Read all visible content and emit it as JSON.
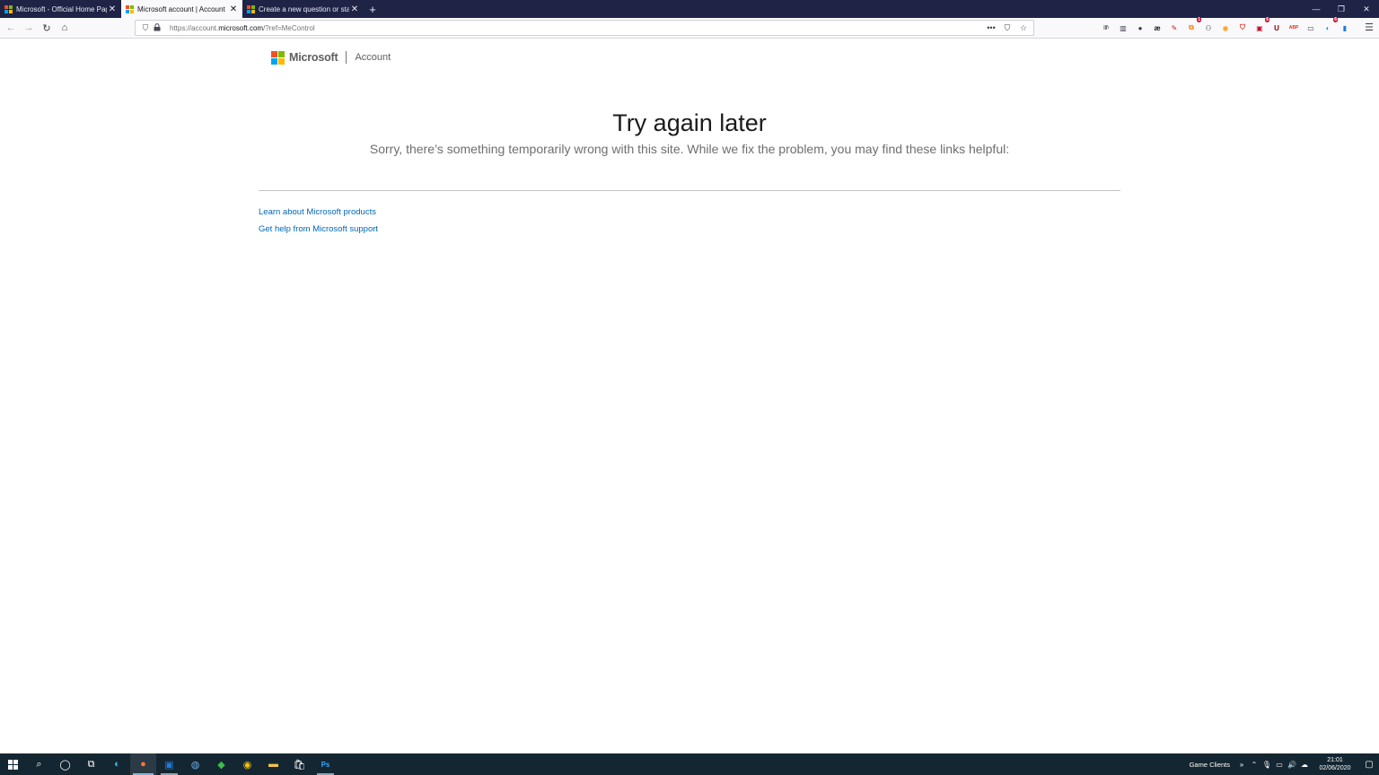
{
  "browser": {
    "tabs": [
      {
        "title": "Microsoft - Official Home Page",
        "active": false
      },
      {
        "title": "Microsoft account | Account",
        "active": true
      },
      {
        "title": "Create a new question or start a",
        "active": false
      }
    ],
    "new_tab_symbol": "+",
    "window_controls": {
      "minimize": "—",
      "restore": "❐",
      "close": "✕"
    },
    "url_prefix": "https://account.",
    "url_domain": "microsoft.com",
    "url_suffix": "/?ref=MeControl",
    "extensions": [
      {
        "name": "library-icon",
        "glyph": "|||\\",
        "color": "#3b3b45"
      },
      {
        "name": "sidebar-icon",
        "glyph": "▥",
        "color": "#3b3b45"
      },
      {
        "name": "account-icon",
        "glyph": "●",
        "color": "#3b3b45"
      },
      {
        "name": "ae-extension-icon",
        "glyph": "æ",
        "color": "#15141a"
      },
      {
        "name": "red-pen-extension-icon",
        "glyph": "✎",
        "color": "#d01717"
      },
      {
        "name": "orange-extension-icon",
        "glyph": "⧉",
        "color": "#f28c28",
        "badge": "1"
      },
      {
        "name": "group-extension-icon",
        "glyph": "⚇",
        "color": "#3b3b45"
      },
      {
        "name": "honey-extension-icon",
        "glyph": "◉",
        "color": "#f29e1f"
      },
      {
        "name": "brave-shield-icon",
        "glyph": "⛉",
        "color": "#e0301e"
      },
      {
        "name": "red-extension-icon",
        "glyph": "▣",
        "color": "#c8102e",
        "badge": "6"
      },
      {
        "name": "ublock-icon",
        "glyph": "U",
        "color": "#800000"
      },
      {
        "name": "abp-icon",
        "glyph": "ABP",
        "color": "#e0301e"
      },
      {
        "name": "square-extension-icon",
        "glyph": "▭",
        "color": "#3b3b45"
      },
      {
        "name": "teal-extension-icon",
        "glyph": "◐",
        "color": "#19a3a3",
        "badge": "6"
      },
      {
        "name": "trello-extension-icon",
        "glyph": "▮",
        "color": "#1f7bd0"
      }
    ]
  },
  "page": {
    "brand": "Microsoft",
    "section": "Account",
    "title": "Try again later",
    "subtitle": "Sorry, there’s something temporarily wrong with this site. While we fix the problem, you may find these links helpful:",
    "links": [
      "Learn about Microsoft products",
      "Get help from Microsoft support"
    ]
  },
  "taskbar": {
    "tray_label": "Game Clients",
    "time": "21:01",
    "date": "02/06/2020"
  },
  "colors": {
    "ms_red": "#f25022",
    "ms_green": "#7fba00",
    "ms_blue": "#00a4ef",
    "ms_yellow": "#ffb900",
    "link": "#0067b8",
    "tab_strip": "#1f2346",
    "taskbar": "#142631"
  }
}
